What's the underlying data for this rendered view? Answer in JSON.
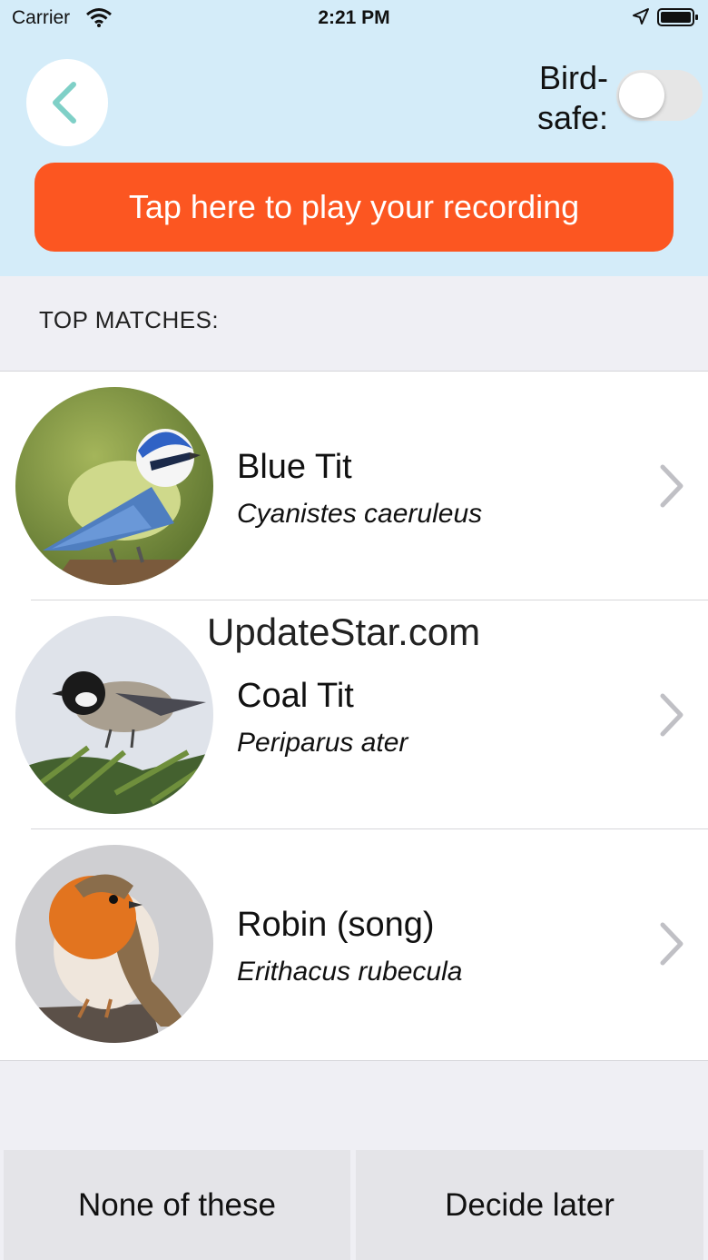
{
  "status_bar": {
    "carrier": "Carrier",
    "time": "2:21 PM"
  },
  "header": {
    "bird_safe_line1": "Bird-",
    "bird_safe_line2": "safe:",
    "bird_safe_on": false,
    "play_label": "Tap here to play your recording",
    "accent_color": "#fc5621"
  },
  "matches": {
    "title": "TOP MATCHES:",
    "items": [
      {
        "name": "Blue Tit",
        "latin": "Cyanistes caeruleus"
      },
      {
        "name": "Coal Tit",
        "latin": "Periparus ater"
      },
      {
        "name": "Robin (song)",
        "latin": "Erithacus rubecula"
      }
    ]
  },
  "watermark": "UpdateStar.com",
  "footer": {
    "none_label": "None of these",
    "later_label": "Decide later"
  }
}
